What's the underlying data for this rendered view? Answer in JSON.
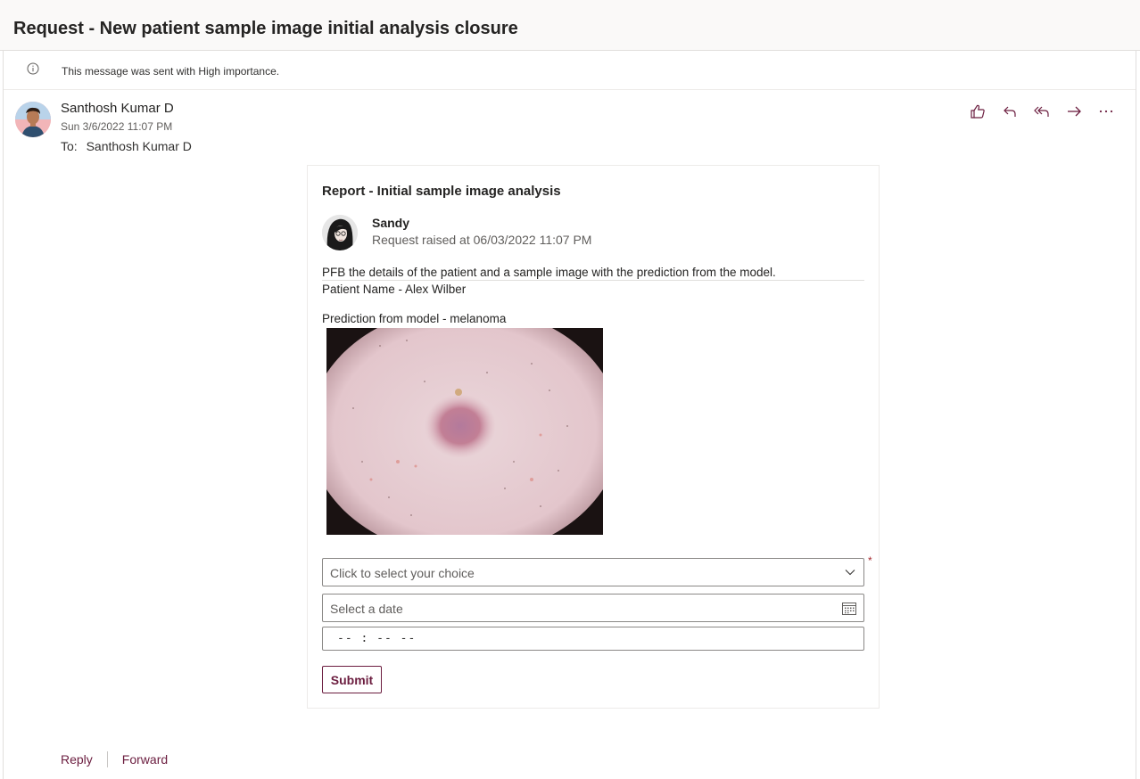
{
  "subject": "Request - New patient sample image initial analysis closure",
  "importance_message": "This message was sent with High importance.",
  "sender": {
    "name": "Santhosh Kumar D",
    "date": "Sun 3/6/2022 11:07 PM",
    "to_label": "To:",
    "to_name": "Santhosh Kumar D"
  },
  "actions": {
    "like_icon": "thumbs-up-icon",
    "reply_icon": "reply-icon",
    "reply_all_icon": "reply-all-icon",
    "forward_icon": "forward-arrow-icon",
    "more_icon": "more-icon"
  },
  "card": {
    "title": "Report - Initial sample image analysis",
    "requester_name": "Sandy",
    "requester_raised": "Request raised at 06/03/2022 11:07 PM",
    "body_line1": "PFB the details of the patient and a sample image with the prediction from the model.",
    "patient_line": "Patient Name - Alex Wilber",
    "prediction_line": "Prediction from model - melanoma",
    "choice_placeholder": "Click to select your choice",
    "required_mark": "*",
    "date_placeholder": "Select a date",
    "time_placeholder": "-- : --  --",
    "submit_label": "Submit"
  },
  "footer": {
    "reply_label": "Reply",
    "forward_label": "Forward"
  },
  "colors": {
    "accent": "#6b1d3f",
    "required": "#a4262c"
  }
}
